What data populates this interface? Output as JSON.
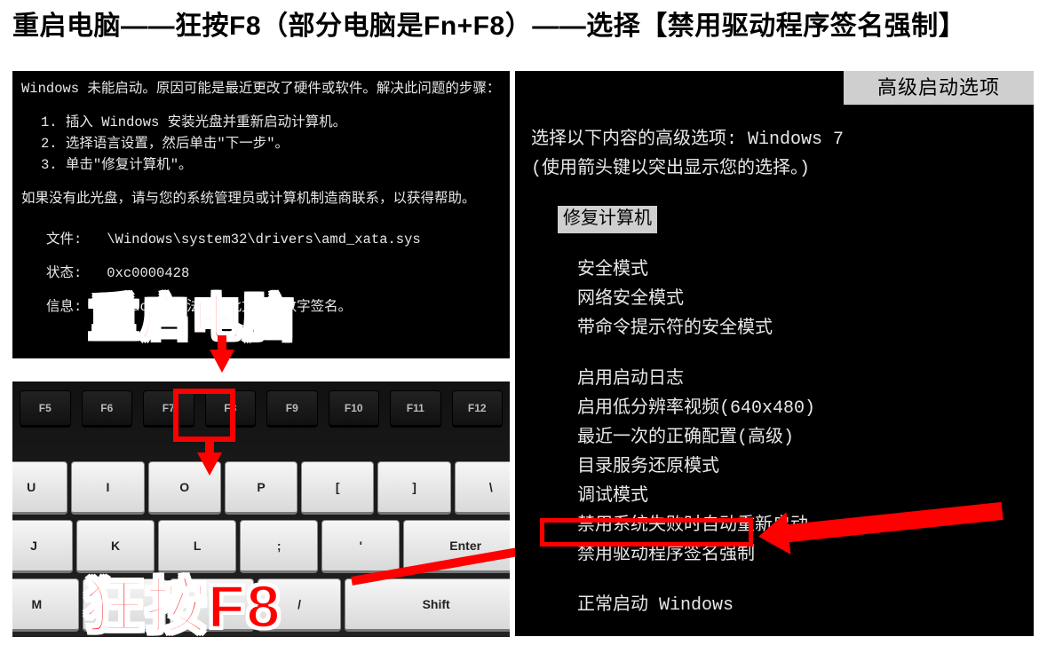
{
  "headline": "重启电脑——狂按F8（部分电脑是Fn+F8）——选择【禁用驱动程序签名强制】",
  "boot_error": {
    "line1": "Windows 未能启动。原因可能是最近更改了硬件或软件。解决此问题的步骤：",
    "step1": "1. 插入 Windows 安装光盘并重新启动计算机。",
    "step2": "2. 选择语言设置，然后单击\"下一步\"。",
    "step3": "3. 单击\"修复计算机\"。",
    "noDisc": "如果没有此光盘，请与您的系统管理员或计算机制造商联系，以获得帮助。",
    "fileLabel": "文件:",
    "fileValue": "\\Windows\\system32\\drivers\\amd_xata.sys",
    "statusLabel": "状态:",
    "statusValue": "0xc0000428",
    "infoLabel": "信息:",
    "infoValue": "Windows 无法验证此文件的数字签名。"
  },
  "restart_label": "重启电脑",
  "press_f8_label": "狂按F8",
  "keyboard": {
    "fn_keys": [
      "F5",
      "F6",
      "F7",
      "F8",
      "F9",
      "F10",
      "F11",
      "F12"
    ],
    "row1": [
      "U",
      "I",
      "O",
      "P",
      "[",
      "]",
      "\\"
    ],
    "row2": [
      "J",
      "K",
      "L",
      ";",
      "'",
      " Enter"
    ],
    "row3": [
      "M",
      ",",
      ".",
      "/",
      " Shift"
    ]
  },
  "adv": {
    "title": "高级启动选项",
    "prompt1": "选择以下内容的高级选项: Windows 7",
    "prompt2": "(使用箭头键以突出显示您的选择。)",
    "repair": "修复计算机",
    "group1": [
      "安全模式",
      "网络安全模式",
      "带命令提示符的安全模式"
    ],
    "group2": [
      "启用启动日志",
      "启用低分辨率视频(640x480)",
      "最近一次的正确配置(高级)",
      "目录服务还原模式",
      "调试模式",
      "禁用系统失败时自动重新启动",
      "禁用驱动程序签名强制"
    ],
    "normal": "正常启动 Windows"
  }
}
